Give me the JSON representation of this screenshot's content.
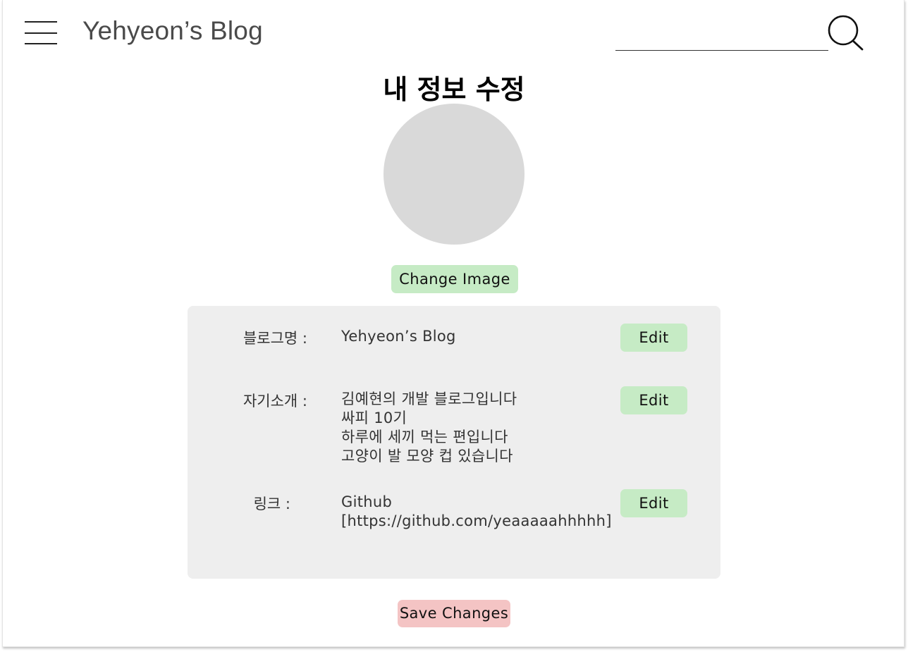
{
  "header": {
    "site_title": "Yehyeon’s Blog",
    "search": {
      "value": "",
      "placeholder": ""
    }
  },
  "page": {
    "title": "내 정보 수정",
    "change_image_label": "Change Image",
    "save_label": "Save Changes"
  },
  "fields": {
    "blog_name": {
      "label": "블로그명 :",
      "value": "Yehyeon’s Blog",
      "edit_label": "Edit"
    },
    "intro": {
      "label": "자기소개 :",
      "lines": [
        "김예현의 개발 블로그입니다",
        "싸피 10기",
        "하루에 세끼 먹는 편입니다",
        "고양이 발 모양 컵 있습니다"
      ],
      "edit_label": "Edit"
    },
    "link": {
      "label": "링크 :",
      "lines": [
        "Github",
        "[https://github.com/yeaaaaahhhhh]"
      ],
      "edit_label": "Edit"
    }
  },
  "colors": {
    "button_green": "#c6ebc5",
    "button_red": "#f4c4c4",
    "panel_bg": "#eeeeee",
    "avatar_bg": "#d9d9d9"
  },
  "icons": {
    "menu": "hamburger-menu-icon",
    "search": "search-icon"
  }
}
